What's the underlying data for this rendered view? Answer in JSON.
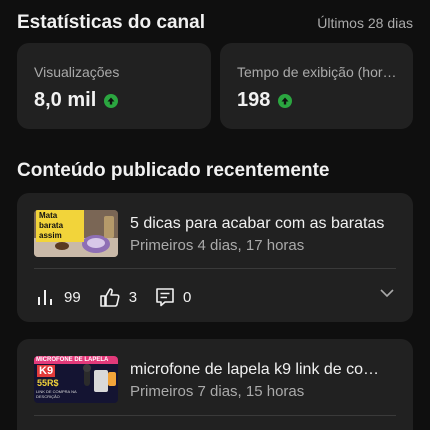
{
  "header": {
    "title": "Estatísticas do canal",
    "period": "Últimos 28 dias"
  },
  "stats": [
    {
      "label": "Visualizações",
      "value": "8,0 mil",
      "trend": "up-arrow-icon"
    },
    {
      "label": "Tempo de exibição (hor…",
      "value": "198",
      "trend": "up-arrow-icon"
    }
  ],
  "recent": {
    "title": "Conteúdo publicado recentemente",
    "videos": [
      {
        "thumb_text": "Mata barata assim",
        "title": "5 dicas para acabar com as baratas",
        "subtitle": "Primeiros 4 dias, 17 horas",
        "views": "99",
        "likes": "3",
        "comments": "0"
      },
      {
        "thumb_text": "MICROFONE DE LAPELA",
        "thumb_brand": "K9",
        "thumb_price": "55R$",
        "thumb_caption": "LINK DE COMPRA NA DESCRIÇÃO",
        "title": "microfone de lapela k9 link de com…",
        "subtitle": "Primeiros 7 dias, 15 horas"
      }
    ]
  },
  "colors": {
    "background": "#0f0f0f",
    "card": "#212121",
    "trend_up": "#2ba640"
  }
}
